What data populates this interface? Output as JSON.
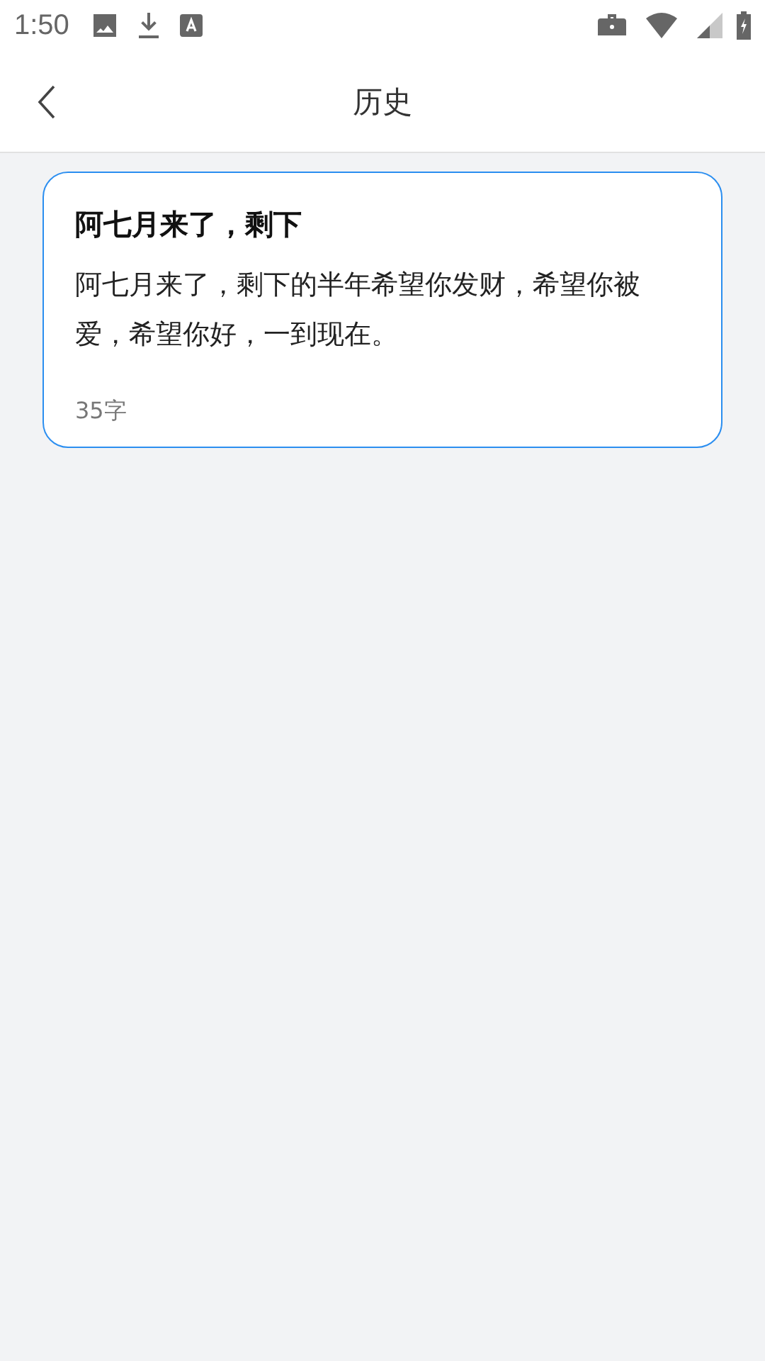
{
  "status_bar": {
    "time": "1:50"
  },
  "header": {
    "title": "历史"
  },
  "history": [
    {
      "title": "阿七月来了，剩下",
      "body": "阿七月来了，剩下的半年希望你发财，希望你被爱，希望你好，一到现在。",
      "count": "35字"
    }
  ]
}
